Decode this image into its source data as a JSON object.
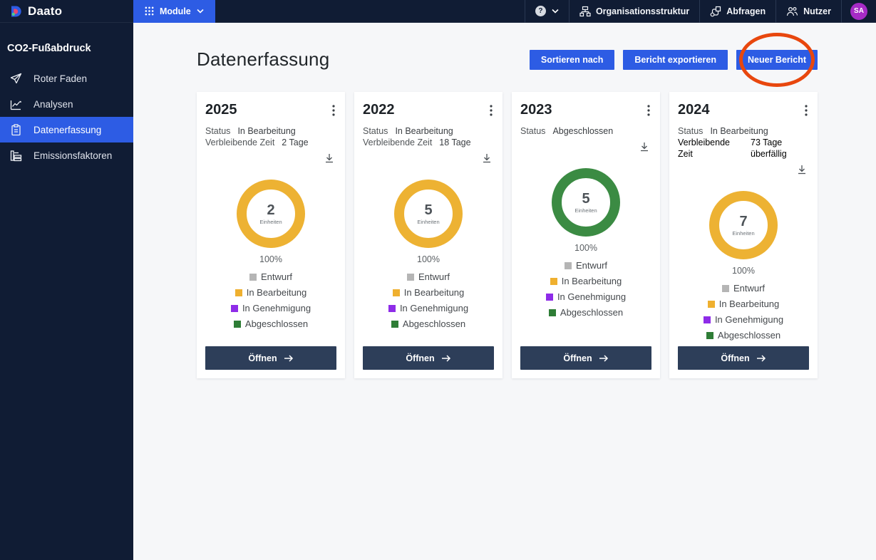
{
  "topbar": {
    "logo": "Daato",
    "module_label": "Module",
    "help_label": "?",
    "nav": [
      {
        "icon": "org-structure",
        "label": "Organisationsstruktur"
      },
      {
        "icon": "queries",
        "label": "Abfragen"
      },
      {
        "icon": "users",
        "label": "Nutzer"
      }
    ],
    "avatar": {
      "initials": "SA",
      "color": "#a62bc6"
    }
  },
  "sidebar": {
    "title": "CO2-Fußabdruck",
    "items": [
      {
        "icon": "paper-plane",
        "label": "Roter Faden",
        "active": false
      },
      {
        "icon": "line-chart",
        "label": "Analysen",
        "active": false
      },
      {
        "icon": "clipboard",
        "label": "Datenerfassung",
        "active": true
      },
      {
        "icon": "emission-bars",
        "label": "Emissionsfaktoren",
        "active": false
      }
    ]
  },
  "main": {
    "title": "Datenerfassung",
    "actions": [
      {
        "label": "Sortieren nach"
      },
      {
        "label": "Bericht exportieren"
      },
      {
        "label": "Neuer Bericht",
        "annotated": true
      }
    ],
    "annotation": {
      "shape": "hand-drawn-ellipse",
      "color": "#e8470e",
      "target": "Neuer Bericht"
    }
  },
  "labels": {
    "status": "Status",
    "remaining": "Verbleibende Zeit",
    "units": "Einheiten",
    "open": "Öffnen"
  },
  "legend": [
    {
      "label": "Entwurf",
      "color": "#b5b5b5"
    },
    {
      "label": "In Bearbeitung",
      "color": "#efb02f"
    },
    {
      "label": "In Genehmigung",
      "color": "#8e2ce8"
    },
    {
      "label": "Abgeschlossen",
      "color": "#2e7d36"
    }
  ],
  "cards": [
    {
      "year": "2025",
      "status": "In Bearbeitung",
      "remaining": "2 Tage",
      "donut": {
        "units": "2",
        "percent": "100%",
        "color": "#edb233",
        "filled": "100%"
      }
    },
    {
      "year": "2022",
      "status": "In Bearbeitung",
      "remaining": "18 Tage",
      "donut": {
        "units": "5",
        "percent": "100%",
        "color": "#edb233",
        "filled": "100%"
      }
    },
    {
      "year": "2023",
      "status": "Abgeschlossen",
      "remaining": null,
      "donut": {
        "units": "5",
        "percent": "100%",
        "color": "#3b8b43",
        "filled": "100%"
      }
    },
    {
      "year": "2024",
      "status": "In Bearbeitung",
      "remaining": "73 Tage überfällig",
      "donut": {
        "units": "7",
        "percent": "100%",
        "color": "#edb233",
        "filled": "100%"
      }
    }
  ]
}
